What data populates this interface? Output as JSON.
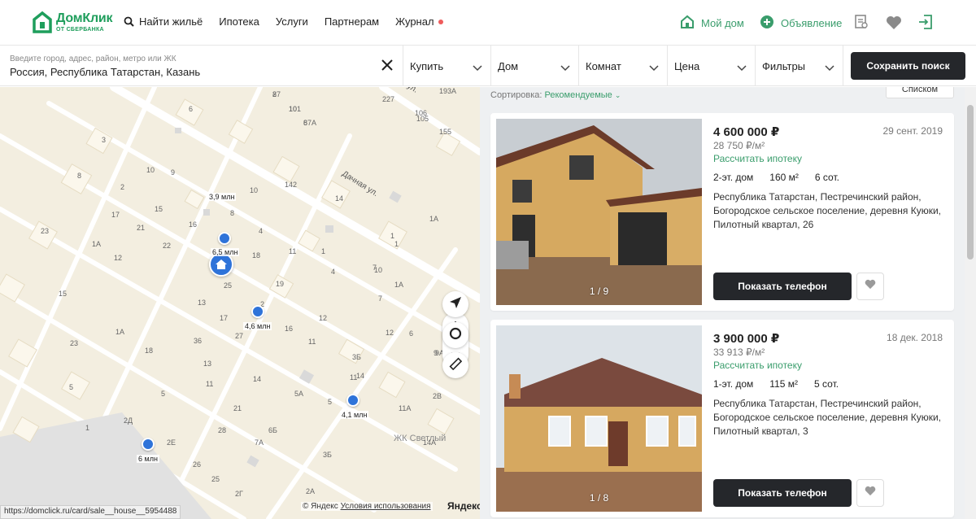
{
  "header": {
    "logo_main": "ДомКлик",
    "logo_sub": "ОТ СБЕРБАНКА",
    "nav": [
      {
        "label": "Найти жильё",
        "icon": "search-icon"
      },
      {
        "label": "Ипотека"
      },
      {
        "label": "Услуги"
      },
      {
        "label": "Партнерам"
      },
      {
        "label": "Журнал",
        "badge": "red-dot"
      }
    ],
    "my_home": "Мой дом",
    "ad": "Объявление"
  },
  "search": {
    "placeholder": "Введите город, адрес, район, метро или ЖК",
    "value": "Россия, Республика Татарстан, Казань",
    "filters": [
      {
        "label": "Купить"
      },
      {
        "label": "Дом"
      },
      {
        "label": "Комнат"
      },
      {
        "label": "Цена"
      },
      {
        "label": "Фильтры"
      }
    ],
    "save_label": "Сохранить поиск"
  },
  "map": {
    "street_1": "Дачная ул.",
    "street_2": "ул.",
    "complex_label": "ЖК Светлый",
    "house_price": "3,9 млн",
    "pins": [
      {
        "label": "6,5 млн"
      },
      {
        "label": "4,6 млн"
      },
      {
        "label": "4,1 млн"
      },
      {
        "label": "6 млн"
      }
    ],
    "footer_copy": "© Яндекс",
    "footer_terms": "Условия использования",
    "yandex_logo": "Яндекс",
    "status_url": "https://domclick.ru/card/sale__house__5954488",
    "house_numbers": [
      "87",
      "101",
      "87А",
      "227",
      "106",
      "105",
      "193А",
      "155",
      "6",
      "3",
      "8",
      "9",
      "10",
      "2",
      "15",
      "16",
      "17",
      "21",
      "22",
      "1А",
      "23",
      "12",
      "18",
      "25",
      "19",
      "2",
      "13",
      "14",
      "1А",
      "1",
      "142",
      "10",
      "8",
      "4",
      "11",
      "1",
      "4",
      "10",
      "12",
      "11",
      "20",
      "16",
      "17",
      "36",
      "13",
      "27",
      "7",
      "1А",
      "6",
      "9",
      "12",
      "14",
      "5А",
      "5",
      "11",
      "11А",
      "3Б",
      "9А",
      "23",
      "18",
      "15",
      "1А",
      "14",
      "11",
      "5",
      "21",
      "28",
      "6Б",
      "7А",
      "3Б",
      "26",
      "25",
      "2Г",
      "2Д",
      "2Е",
      "2А",
      "2В",
      "7",
      "14А",
      "1",
      "5",
      "1",
      "2",
      "10",
      "6"
    ]
  },
  "listing": {
    "sort_label": "Сортировка:",
    "sort_value": "Рекомендуемые",
    "view_label": "Списком",
    "cards": [
      {
        "price": "4 600 000 ₽",
        "price_per_m": "28 750 ₽/м²",
        "date": "29 сент. 2019",
        "mortgage": "Рассчитать ипотеку",
        "floors": "2-эт. дом",
        "area": "160 м²",
        "land": "6 сот.",
        "address": "Республика Татарстан, Пестречинский район, Богородское сельское поселение, деревня Куюки, Пилотный квартал, 26",
        "photo_counter": "1 / 9",
        "phone_label": "Показать телефон"
      },
      {
        "price": "3 900 000 ₽",
        "price_per_m": "33 913 ₽/м²",
        "date": "18 дек. 2018",
        "mortgage": "Рассчитать ипотеку",
        "floors": "1-эт. дом",
        "area": "115 м²",
        "land": "5 сот.",
        "address": "Республика Татарстан, Пестречинский район, Богородское сельское поселение, деревня Куюки, Пилотный квартал, 3",
        "photo_counter": "1 / 8",
        "phone_label": "Показать телефон"
      }
    ]
  },
  "colors": {
    "brand_green": "#1f9e5c",
    "accent_green": "#3a9d6c",
    "button_dark": "#25272b",
    "pin_blue": "#2e73d9"
  }
}
